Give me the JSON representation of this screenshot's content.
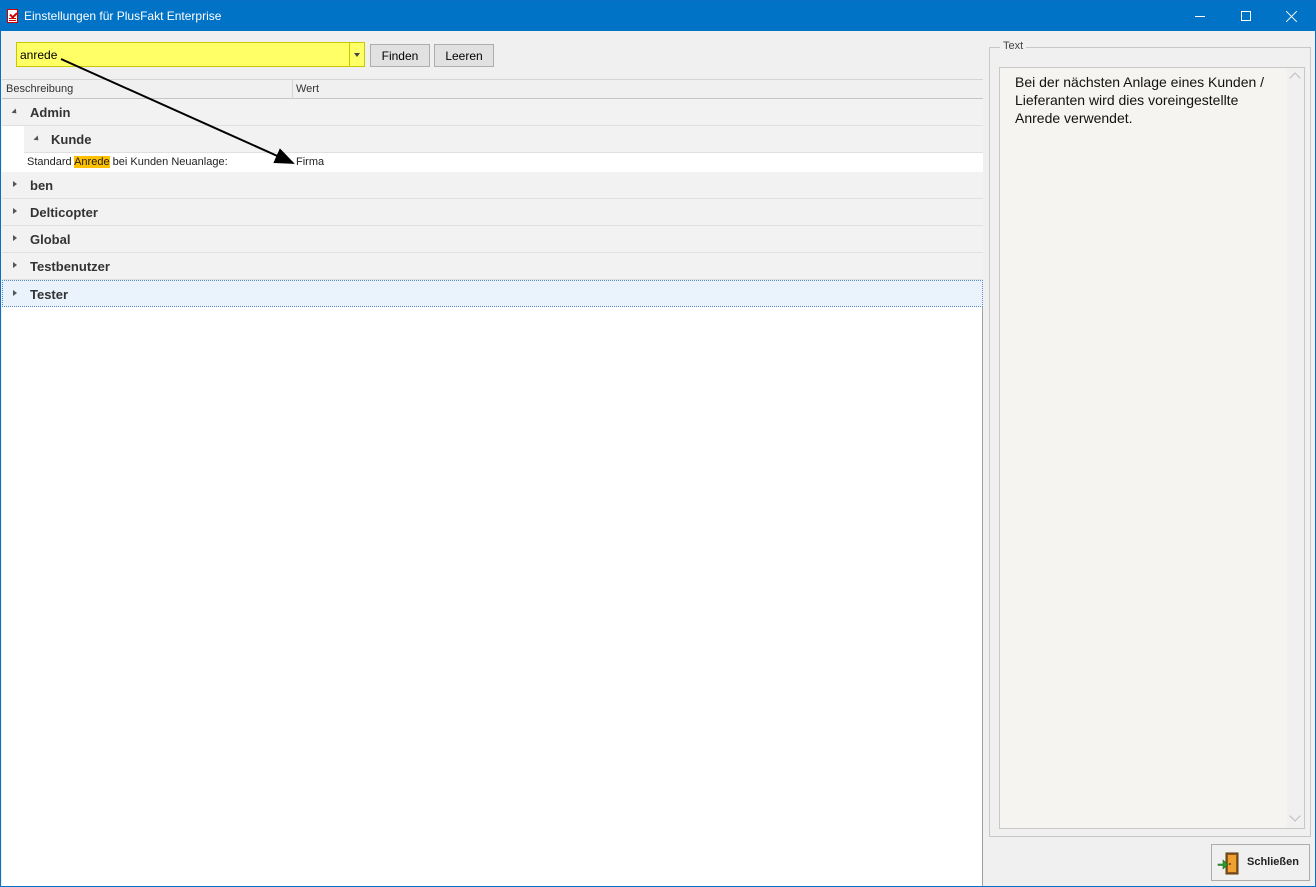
{
  "window": {
    "title": "Einstellungen für PlusFakt Enterprise"
  },
  "search": {
    "value": "anrede",
    "find_label": "Finden",
    "clear_label": "Leeren"
  },
  "columns": {
    "description": "Beschreibung",
    "value": "Wert"
  },
  "tree": {
    "groups": [
      {
        "label": "Admin",
        "expanded": true
      },
      {
        "label": "ben",
        "expanded": false
      },
      {
        "label": "Delticopter",
        "expanded": false
      },
      {
        "label": "Global",
        "expanded": false
      },
      {
        "label": "Testbenutzer",
        "expanded": false
      },
      {
        "label": "Tester",
        "expanded": false,
        "selected": true
      }
    ],
    "subgroup": {
      "label": "Kunde",
      "expanded": true
    },
    "setting": {
      "desc_before": "Standard ",
      "desc_highlight": "Anrede",
      "desc_after": " bei Kunden Neuanlage:",
      "value": "Firma"
    }
  },
  "text_panel": {
    "legend": "Text",
    "content": "Bei der nächsten Anlage eines Kunden / Lieferanten wird dies voreingestellte Anrede verwendet."
  },
  "close_button": {
    "label": "Schließen"
  },
  "colors": {
    "titlebar": "#0173c7",
    "search_highlight": "#ffff66",
    "match_highlight": "#ffc000"
  }
}
